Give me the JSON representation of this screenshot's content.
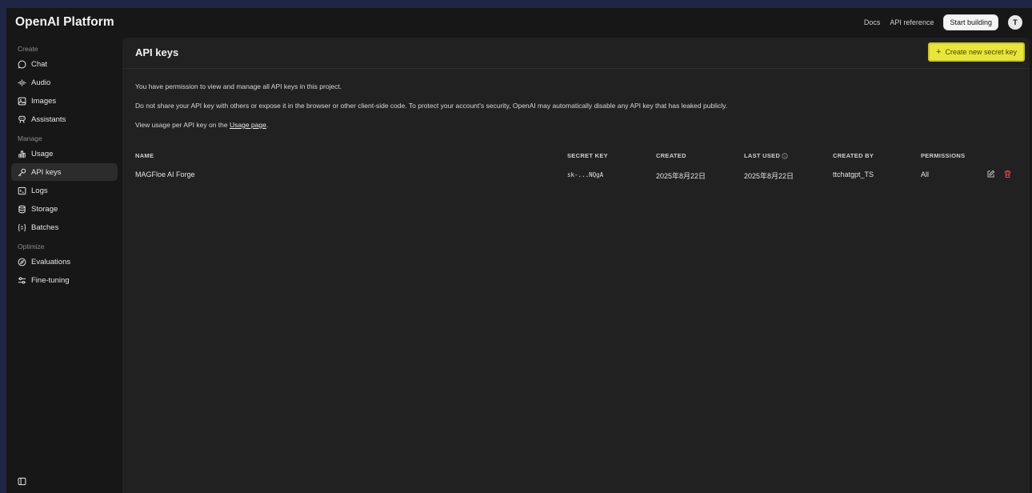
{
  "app": {
    "title": "OpenAI Platform"
  },
  "topbar": {
    "docs": "Docs",
    "api_reference": "API reference",
    "start_building": "Start building",
    "avatar_initial": "T"
  },
  "sidebar": {
    "sections": [
      {
        "label": "Create"
      },
      {
        "label": "Manage"
      },
      {
        "label": "Optimize"
      }
    ],
    "items": [
      {
        "label": "Chat",
        "icon": "chat-icon"
      },
      {
        "label": "Audio",
        "icon": "audio-icon"
      },
      {
        "label": "Images",
        "icon": "images-icon"
      },
      {
        "label": "Assistants",
        "icon": "assistants-icon"
      },
      {
        "label": "Usage",
        "icon": "usage-icon"
      },
      {
        "label": "API keys",
        "icon": "key-icon",
        "active": true
      },
      {
        "label": "Logs",
        "icon": "logs-icon"
      },
      {
        "label": "Storage",
        "icon": "storage-icon"
      },
      {
        "label": "Batches",
        "icon": "batches-icon"
      },
      {
        "label": "Evaluations",
        "icon": "evaluations-icon"
      },
      {
        "label": "Fine-tuning",
        "icon": "fine-tuning-icon"
      }
    ]
  },
  "main": {
    "title": "API keys",
    "create_button": "Create new secret key",
    "info": {
      "line1": "You have permission to view and manage all API keys in this project.",
      "line2": "Do not share your API key with others or expose it in the browser or other client-side code. To protect your account's security, OpenAI may automatically disable any API key that has leaked publicly.",
      "line3_prefix": "View usage per API key on the ",
      "line3_link": "Usage page",
      "line3_suffix": "."
    },
    "table": {
      "headers": {
        "name": "NAME",
        "secret_key": "SECRET KEY",
        "created": "CREATED",
        "last_used": "LAST USED",
        "created_by": "CREATED BY",
        "permissions": "PERMISSIONS"
      },
      "rows": [
        {
          "name": "MAGFloe AI Forge",
          "secret_key": "sk-...NQgA",
          "created": "2025年8月22日",
          "last_used": "2025年8月22日",
          "created_by": "ttchatgpt_TS",
          "permissions": "All"
        }
      ]
    }
  },
  "colors": {
    "accent_yellow": "#e8e63a",
    "delete_red": "#e5484d",
    "background": "#171717",
    "panel": "#212121"
  }
}
